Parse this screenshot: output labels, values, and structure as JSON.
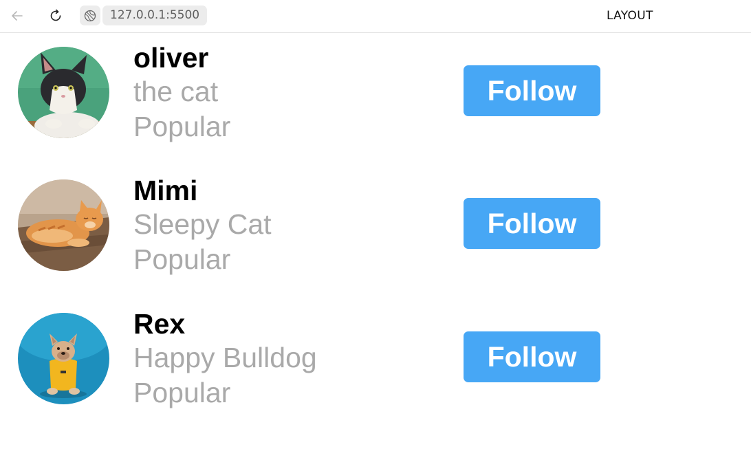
{
  "browser": {
    "url": "127.0.0.1:5500",
    "title_label": "LAYOUT"
  },
  "profiles": [
    {
      "name": "oliver",
      "subtitle": "the cat",
      "status": "Popular",
      "button_label": "Follow",
      "avatar_icon": "cat-photo-icon"
    },
    {
      "name": "Mimi",
      "subtitle": "Sleepy Cat",
      "status": "Popular",
      "button_label": "Follow",
      "avatar_icon": "cat-photo-icon"
    },
    {
      "name": "Rex",
      "subtitle": "Happy Bulldog",
      "status": "Popular",
      "button_label": "Follow",
      "avatar_icon": "dog-photo-icon"
    }
  ],
  "colors": {
    "button_bg": "#47a7f5",
    "secondary_text": "#a9a9a9"
  }
}
